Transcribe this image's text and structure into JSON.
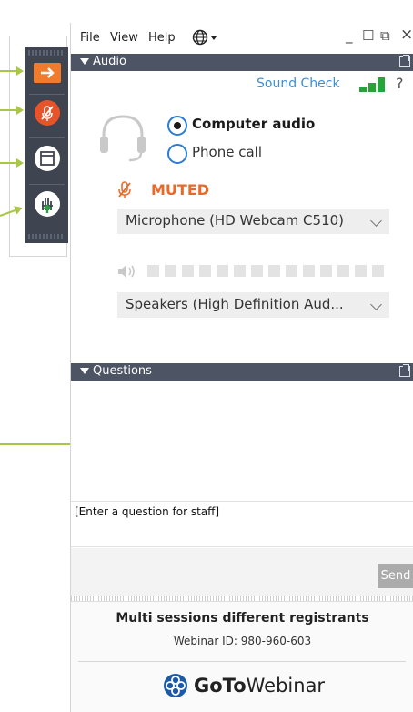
{
  "menubar": {
    "file": "File",
    "view": "View",
    "help": "Help",
    "minimize": "_",
    "restore": "☐",
    "popout": "⧉",
    "close": "×"
  },
  "audio": {
    "header": "Audio",
    "sound_check": "Sound Check",
    "help": "?",
    "options": {
      "computer": "Computer audio",
      "phone": "Phone call",
      "selected": "Computer audio"
    },
    "muted": "MUTED",
    "microphone": "Microphone (HD Webcam C510)",
    "speakers": "Speakers (High Definition Aud...",
    "signal_level": 0.66,
    "mic_level": 0
  },
  "questions": {
    "header": "Questions",
    "input_placeholder": "[Enter a question for staff]",
    "send": "Send"
  },
  "footer": {
    "session_title": "Multi sessions different registrants",
    "webinar_id": "Webinar ID: 980-960-603",
    "brand_bold": "GoTo",
    "brand_rest": "Webinar"
  },
  "colors": {
    "accent_orange": "#f07b2c",
    "muted_red": "#e8532a",
    "link_blue": "#3b8fd6",
    "signal_green": "#26a33b",
    "header_bg": "#4d5564",
    "arrow_green": "#a9c646"
  }
}
